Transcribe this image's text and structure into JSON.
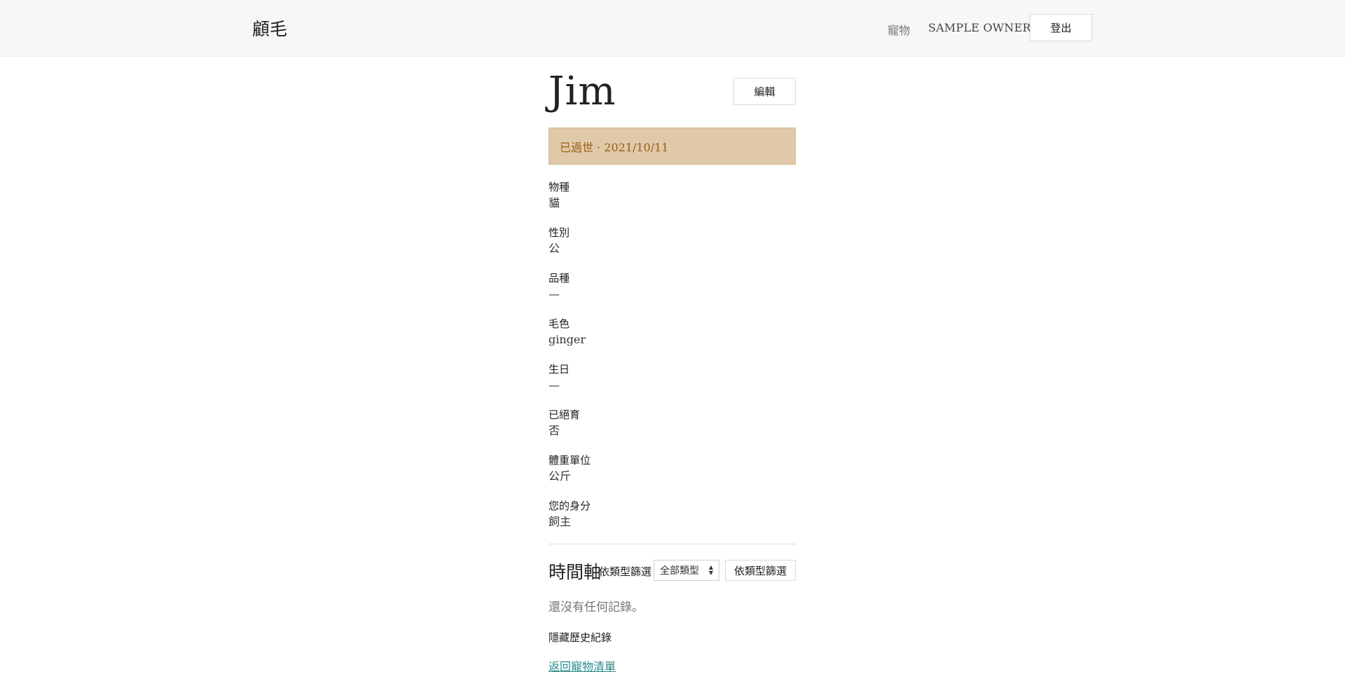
{
  "header": {
    "brand": "顧毛",
    "nav_pets": "寵物",
    "owner_name": "SAMPLE OWNER",
    "logout_label": "登出"
  },
  "pet": {
    "name": "Jim",
    "edit_label": "編輯",
    "deceased_text": "已過世 · 2021/10/11",
    "fields": [
      {
        "label": "物種",
        "value": "貓"
      },
      {
        "label": "性別",
        "value": "公"
      },
      {
        "label": "品種",
        "value": "—"
      },
      {
        "label": "毛色",
        "value": "ginger"
      },
      {
        "label": "生日",
        "value": "—"
      },
      {
        "label": "已絕育",
        "value": "否"
      },
      {
        "label": "體重單位",
        "value": "公斤"
      },
      {
        "label": "您的身分",
        "value": "飼主"
      }
    ]
  },
  "timeline": {
    "title": "時間軸",
    "filter_label": "依類型篩選",
    "filter_selected": "全部類型",
    "filter_button": "依類型篩選",
    "empty_text": "還沒有任何記錄。",
    "hide_history": "隱藏歷史紀錄"
  },
  "footer": {
    "back_link": "返回寵物清單"
  },
  "colors": {
    "banner_bg": "#e0c9a9",
    "banner_text": "#9a5d12",
    "link": "#2a8a8a",
    "topbar_bg": "#f7f7f7"
  }
}
